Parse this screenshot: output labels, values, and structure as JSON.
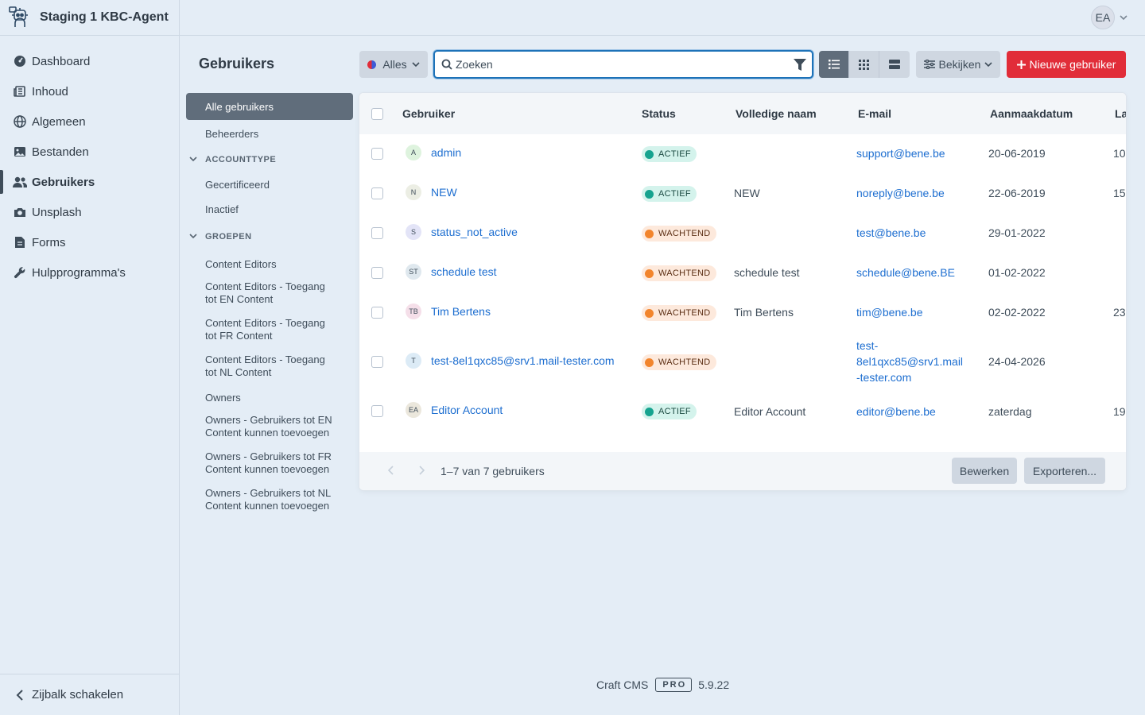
{
  "site": {
    "name": "Staging 1 KBC-Agent",
    "logo_icon": "robot-logo-icon"
  },
  "nav": [
    {
      "label": "Dashboard",
      "icon": "gauge-icon"
    },
    {
      "label": "Inhoud",
      "icon": "newspaper-icon"
    },
    {
      "label": "Algemeen",
      "icon": "globe-icon"
    },
    {
      "label": "Bestanden",
      "icon": "image-icon"
    },
    {
      "label": "Gebruikers",
      "icon": "users-icon",
      "active": true
    },
    {
      "label": "Unsplash",
      "icon": "camera-icon"
    },
    {
      "label": "Forms",
      "icon": "file-icon"
    },
    {
      "label": "Hulpprogramma's",
      "icon": "wrench-icon"
    }
  ],
  "sidebar_toggle": "Zijbalk schakelen",
  "account": {
    "initials": "EA"
  },
  "page": {
    "title": "Gebruikers"
  },
  "sources": {
    "all": "Alle gebruikers",
    "admins": "Beheerders",
    "accounttype_heading": "ACCOUNTTYPE",
    "accounttype": [
      "Gecertificeerd",
      "Inactief"
    ],
    "groups_heading": "GROEPEN",
    "groups": [
      "Content Editors",
      "Content Editors - Toegang tot EN Content",
      "Content Editors - Toegang tot FR Content",
      "Content Editors - Toegang tot NL Content",
      "Owners",
      "Owners - Gebruikers tot EN Content kunnen toevoegen",
      "Owners - Gebruikers tot FR Content kunnen toevoegen",
      "Owners - Gebruikers tot NL Content kunnen toevoegen"
    ]
  },
  "toolbar": {
    "status_label": "Alles",
    "search_placeholder": "Zoeken",
    "view_label": "Bekijken",
    "new_label": "Nieuwe gebruiker"
  },
  "table": {
    "columns": [
      "Gebruiker",
      "Status",
      "Volledige naam",
      "E-mail",
      "Aanmaakdatum",
      "La"
    ],
    "rows": [
      {
        "initials": "A",
        "user": "admin",
        "status": "ACTIEF",
        "status_type": "active",
        "full_name": "",
        "email": "support@bene.be",
        "created": "20-06-2019",
        "last": "10"
      },
      {
        "initials": "N",
        "user": "NEW",
        "status": "ACTIEF",
        "status_type": "active",
        "full_name": "NEW",
        "email": "noreply@bene.be",
        "created": "22-06-2019",
        "last": "15"
      },
      {
        "initials": "S",
        "user": "status_not_active",
        "status": "WACHTEND",
        "status_type": "pending",
        "full_name": "",
        "email": "test@bene.be",
        "created": "29-01-2022",
        "last": ""
      },
      {
        "initials": "ST",
        "user": "schedule test",
        "status": "WACHTEND",
        "status_type": "pending",
        "full_name": "schedule test",
        "email": "schedule@bene.BE",
        "created": "01-02-2022",
        "last": ""
      },
      {
        "initials": "TB",
        "user": "Tim Bertens",
        "status": "WACHTEND",
        "status_type": "pending",
        "full_name": "Tim Bertens",
        "email": "tim@bene.be",
        "created": "02-02-2022",
        "last": "23"
      },
      {
        "initials": "T",
        "user": "test-8el1qxc85@srv1.mail-tester.com",
        "status": "WACHTEND",
        "status_type": "pending",
        "full_name": "",
        "email_lines": [
          "test-",
          "8el1qxc85@srv1.mail",
          "-tester.com"
        ],
        "created": "24-04-2026",
        "last": ""
      },
      {
        "initials": "EA",
        "user": "Editor Account",
        "status": "ACTIEF",
        "status_type": "active",
        "full_name": "Editor Account",
        "email": "editor@bene.be",
        "created": "zaterdag",
        "last": "19"
      }
    ],
    "count_label": "1–7 van 7 gebruikers",
    "edit_label": "Bewerken",
    "export_label": "Exporteren..."
  },
  "footer": {
    "product": "Craft CMS",
    "edition": "PRO",
    "version": "5.9.22"
  },
  "colors": {
    "accent": "#e12d39",
    "link": "#1d6ed0",
    "active_status": "#16a38f",
    "pending_status": "#f2852d"
  }
}
